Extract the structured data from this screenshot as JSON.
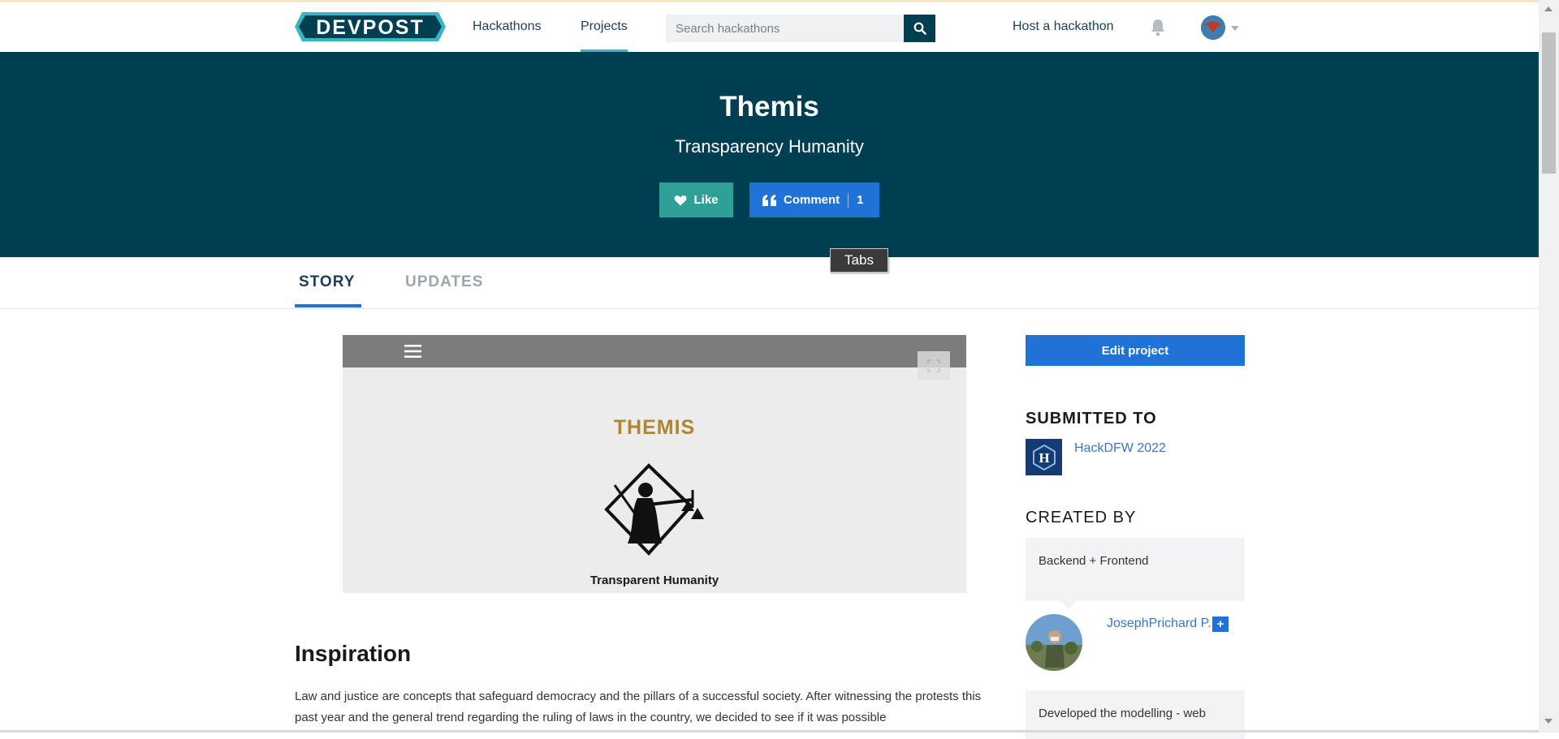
{
  "brand": {
    "name": "DEVPOST",
    "colors": {
      "navy": "#003e52",
      "teal": "#34b7c3",
      "blue": "#1f72d6",
      "like_green": "#2ea097"
    }
  },
  "nav": {
    "hackathons": "Hackathons",
    "projects": "Projects",
    "search_placeholder": "Search hackathons",
    "host": "Host a hackathon"
  },
  "project": {
    "title": "Themis",
    "tagline": "Transparency Humanity",
    "like_label": "Like",
    "comment_label": "Comment",
    "comment_count": "1"
  },
  "tooltip": "Tabs",
  "tabs": {
    "story": "STORY",
    "updates": "UPDATES"
  },
  "gallery": {
    "slide_title": "THEMIS",
    "slide_caption": "Transparent Humanity"
  },
  "story": {
    "heading": "Inspiration",
    "paragraph": "Law and justice are concepts that safeguard democracy and the pillars of a successful society. After witnessing the protests this past year and the general trend regarding the ruling of laws in the country, we decided to see if it was possible"
  },
  "sidebar": {
    "edit_button": "Edit project",
    "submitted_heading": "SUBMITTED TO",
    "hackathon_name": "HackDFW 2022",
    "hackathon_initial": "H",
    "created_heading": "CREATED BY",
    "members": [
      {
        "role": "Backend + Frontend",
        "name": "JosephPrichard P.",
        "follow": "+"
      },
      {
        "role": "Developed the modelling - web"
      }
    ]
  }
}
